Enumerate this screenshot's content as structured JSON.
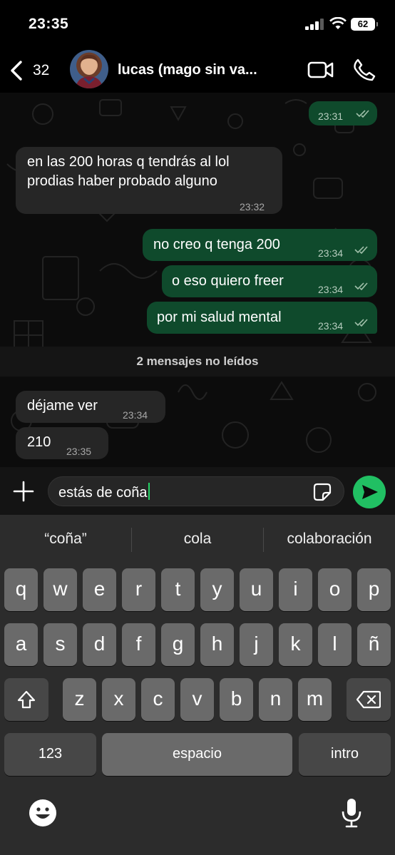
{
  "status_bar": {
    "time": "23:35",
    "battery": "62"
  },
  "header": {
    "back_count": "32",
    "contact_name": "lucas (mago sin va..."
  },
  "messages": [
    {
      "direction": "out",
      "text": "",
      "time": "23:31"
    },
    {
      "direction": "in",
      "line1": "en las 200 horas q tendrás al lol",
      "line2": "prodias haber probado alguno",
      "time": "23:32"
    },
    {
      "direction": "out",
      "text": "no creo q tenga 200",
      "time": "23:34"
    },
    {
      "direction": "out",
      "text": "o eso quiero freer",
      "time": "23:34"
    },
    {
      "direction": "out",
      "text": "por mi salud mental",
      "time": "23:34"
    },
    {
      "direction": "in",
      "text": "déjame ver",
      "time": "23:34"
    },
    {
      "direction": "in",
      "text": "210",
      "time": "23:35"
    }
  ],
  "unread_banner": "2 mensajes no leídos",
  "composer": {
    "text": "estás de coña"
  },
  "keyboard": {
    "suggestions": [
      "“coña”",
      "cola",
      "colaboración"
    ],
    "row1": [
      "q",
      "w",
      "e",
      "r",
      "t",
      "y",
      "u",
      "i",
      "o",
      "p"
    ],
    "row2": [
      "a",
      "s",
      "d",
      "f",
      "g",
      "h",
      "j",
      "k",
      "l",
      "ñ"
    ],
    "row3": [
      "z",
      "x",
      "c",
      "v",
      "b",
      "n",
      "m"
    ],
    "numbers_label": "123",
    "space_label": "espacio",
    "return_label": "intro"
  },
  "colors": {
    "outgoing": "#0f4a2c",
    "incoming": "#262626",
    "accent": "#21c063"
  }
}
